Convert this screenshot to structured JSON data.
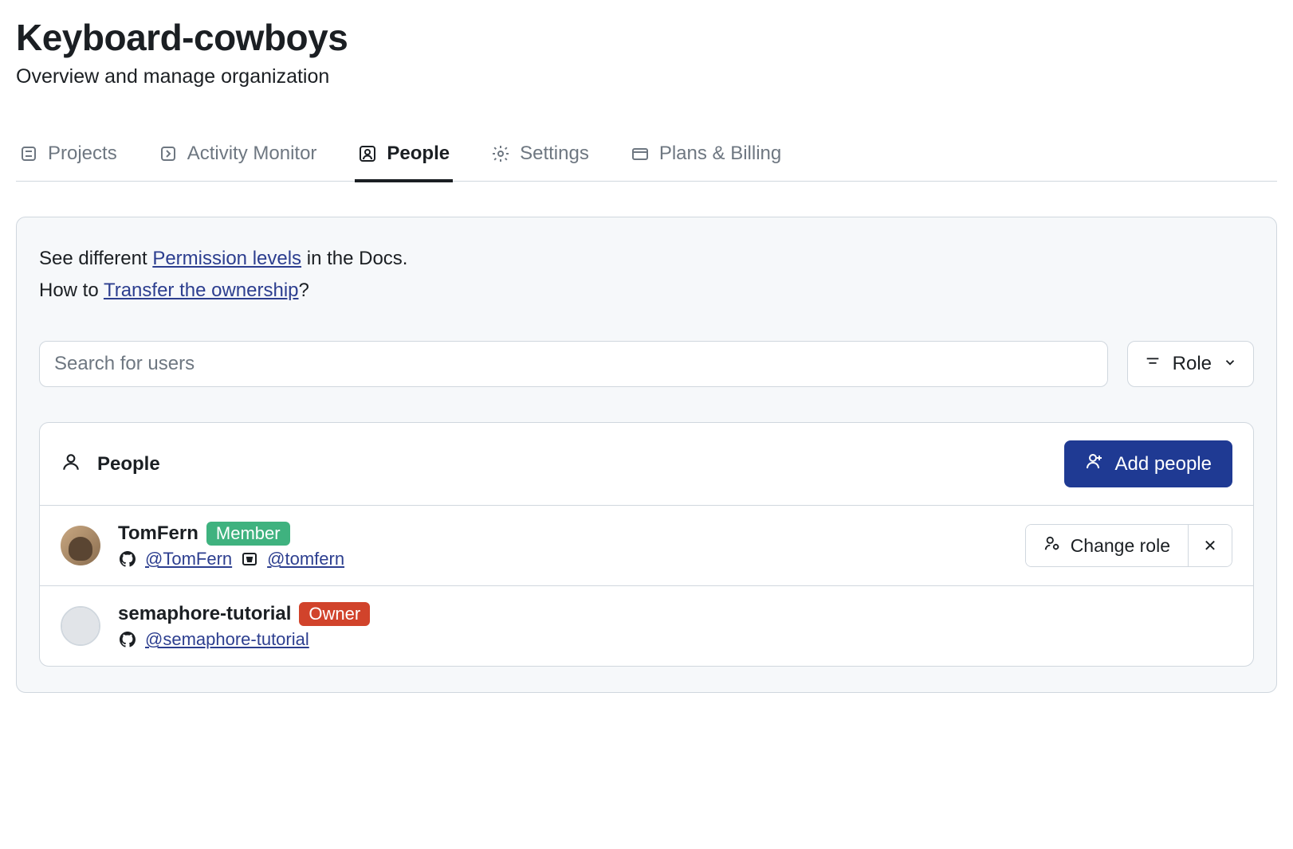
{
  "header": {
    "title": "Keyboard-cowboys",
    "subtitle": "Overview and manage organization"
  },
  "tabs": [
    {
      "label": "Projects"
    },
    {
      "label": "Activity Monitor"
    },
    {
      "label": "People"
    },
    {
      "label": "Settings"
    },
    {
      "label": "Plans & Billing"
    }
  ],
  "info": {
    "text1_pre": "See different ",
    "link1": "Permission levels",
    "text1_post": " in the Docs.",
    "text2_pre": "How to ",
    "link2": "Transfer the ownership",
    "text2_post": "?"
  },
  "search": {
    "placeholder": "Search for users"
  },
  "role_filter": {
    "label": "Role"
  },
  "people_section": {
    "title": "People",
    "add_button": "Add people",
    "change_role": "Change role"
  },
  "people": [
    {
      "name": "TomFern",
      "role": "Member",
      "role_class": "member",
      "gh_handle": "@TomFern",
      "bb_handle": "@tomfern",
      "has_actions": true,
      "avatar_class": "tom"
    },
    {
      "name": "semaphore-tutorial",
      "role": "Owner",
      "role_class": "owner",
      "gh_handle": "@semaphore-tutorial",
      "has_actions": false,
      "avatar_class": "semaphore"
    }
  ]
}
